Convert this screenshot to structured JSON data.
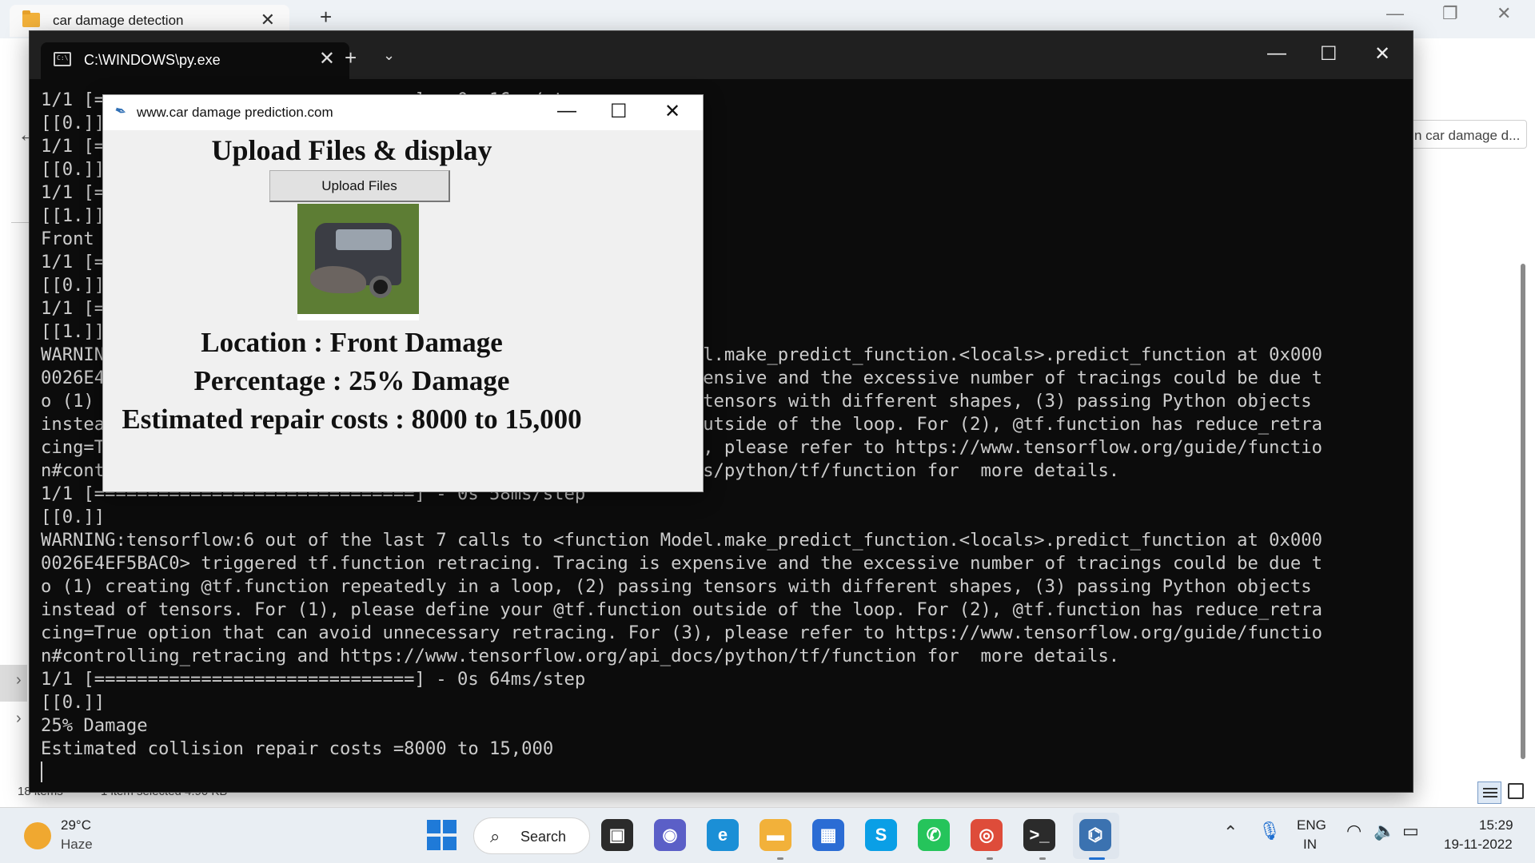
{
  "explorer": {
    "tab_title": "car damage detection",
    "tab_close": "✕",
    "new_tab": "+",
    "minimize": "—",
    "restore": "❐",
    "close": "✕",
    "search_text": "n car damage d...",
    "back": "←",
    "status_items": "18 items",
    "status_selected": "1 item selected  4.90 KB"
  },
  "terminal": {
    "tab_title": "C:\\WINDOWS\\py.exe",
    "tab_icon_text": "C:\\",
    "tab_close": "✕",
    "new_tab": "+",
    "dropdown": "⌄",
    "minimize": "—",
    "maximize": "☐",
    "close": "✕",
    "lines": [
      "1/1 [==============================] - 0s 16ms/step",
      "[[0.]]",
      "1/1 [==============================] - 0s 16ms/step",
      "[[0.]]",
      "1/1 [==============================] - 0s 16ms/step",
      "[[1.]]",
      "Front",
      "1/1 [==============================] - 0s 16ms/step",
      "[[0.]]",
      "1/1 [==============================] - 0s 16ms/step",
      "[[1.]]",
      "WARNING:tensorflow:5 out of the last 6 calls to <function Model.make_predict_function.<locals>.predict_function at 0x000",
      "0026E4EF5BAC0> triggered tf.function retracing. Tracing is expensive and the excessive number of tracings could be due t",
      "o (1) creating @tf.function repeatedly in a loop, (2) passing tensors with different shapes, (3) passing Python objects",
      "instead of tensors. For (1), please define your @tf.function outside of the loop. For (2), @tf.function has reduce_retra",
      "cing=True option that can avoid unnecessary retracing. For (3), please refer to https://www.tensorflow.org/guide/functio",
      "n#controlling_retracing and https://www.tensorflow.org/api_docs/python/tf/function for  more details.",
      "1/1 [==============================] - 0s 58ms/step",
      "[[0.]]",
      "WARNING:tensorflow:6 out of the last 7 calls to <function Model.make_predict_function.<locals>.predict_function at 0x000",
      "0026E4EF5BAC0> triggered tf.function retracing. Tracing is expensive and the excessive number of tracings could be due t",
      "o (1) creating @tf.function repeatedly in a loop, (2) passing tensors with different shapes, (3) passing Python objects",
      "instead of tensors. For (1), please define your @tf.function outside of the loop. For (2), @tf.function has reduce_retra",
      "cing=True option that can avoid unnecessary retracing. For (3), please refer to https://www.tensorflow.org/guide/functio",
      "n#controlling_retracing and https://www.tensorflow.org/api_docs/python/tf/function for  more details.",
      "1/1 [==============================] - 0s 64ms/step",
      "[[0.]]",
      "25% Damage",
      "Estimated collision repair costs =8000 to 15,000"
    ]
  },
  "dialog": {
    "title": "www.car damage prediction.com",
    "minimize": "—",
    "maximize": "☐",
    "close": "✕",
    "heading": "Upload Files & display",
    "upload_button": "Upload Files",
    "image_alt": "damaged car photo",
    "location": "Location :  Front Damage",
    "percentage": "Percentage :  25% Damage",
    "cost": "Estimated repair costs :  8000 to 15,000"
  },
  "taskbar": {
    "temperature": "29°C",
    "weather": "Haze",
    "search_label": "Search",
    "apps": [
      {
        "name": "task-view",
        "glyph": "▣",
        "color": "#2b2b2b"
      },
      {
        "name": "teams-chat",
        "glyph": "◉",
        "color": "#5b5fc7"
      },
      {
        "name": "edge",
        "glyph": "e",
        "color": "#1b8fd6"
      },
      {
        "name": "file-explorer",
        "glyph": "▬",
        "color": "#f2b13a"
      },
      {
        "name": "microsoft-store",
        "glyph": "▦",
        "color": "#2b6cd4"
      },
      {
        "name": "skype",
        "glyph": "S",
        "color": "#0a9fe6"
      },
      {
        "name": "whatsapp",
        "glyph": "✆",
        "color": "#25c45b"
      },
      {
        "name": "chrome",
        "glyph": "◎",
        "color": "#de4c3a"
      },
      {
        "name": "terminal",
        "glyph": ">_",
        "color": "#2b2b2b"
      },
      {
        "name": "python",
        "glyph": "⌬",
        "color": "#3b72b0"
      }
    ],
    "lang_top": "ENG",
    "lang_bottom": "IN",
    "time": "15:29",
    "date": "19-11-2022"
  }
}
